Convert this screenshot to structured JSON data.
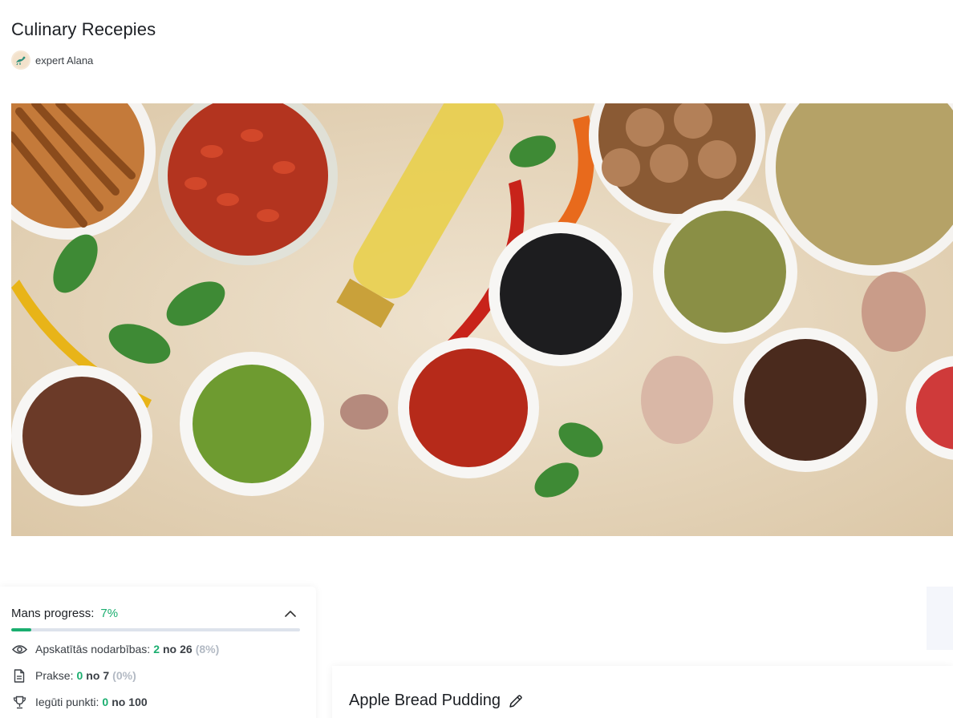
{
  "course": {
    "title": "Culinary Recepies",
    "author": "expert Alana"
  },
  "progress": {
    "label": "Mans progress:",
    "percent_text": "7%",
    "percent_value": 7,
    "stats": [
      {
        "icon": "eye-icon",
        "label": "Apskatītās nodarbības:",
        "done": "2",
        "of_word": "no",
        "total": "26",
        "pct": "(8%)"
      },
      {
        "icon": "document-icon",
        "label": "Prakse:",
        "done": "0",
        "of_word": "no",
        "total": "7",
        "pct": "(0%)"
      },
      {
        "icon": "trophy-icon",
        "label": "Iegūti punkti:",
        "done": "0",
        "of_word": "no",
        "total": "100",
        "pct": ""
      }
    ]
  },
  "lesson": {
    "title": "Apple Bread Pudding",
    "edit_icon": "pencil-icon"
  },
  "colors": {
    "accent": "#1aae6f",
    "track": "#dde3ec",
    "muted": "#b3bac4"
  }
}
